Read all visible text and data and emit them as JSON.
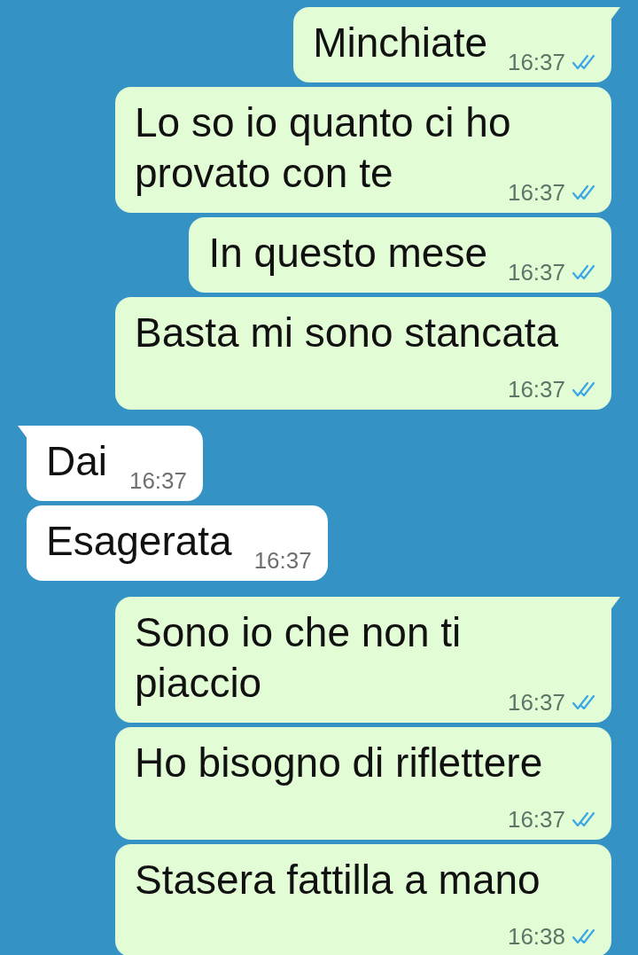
{
  "messages": [
    {
      "kind": "outgoing",
      "tail": true,
      "text": "Minchiate",
      "time": "16:37",
      "read": true
    },
    {
      "kind": "outgoing",
      "tail": false,
      "text": "Lo so io quanto ci ho provato con te",
      "time": "16:37",
      "read": true
    },
    {
      "kind": "outgoing",
      "tail": false,
      "text": "In questo mese",
      "time": "16:37",
      "read": true
    },
    {
      "kind": "outgoing",
      "tail": false,
      "text": "Basta mi sono stancata",
      "time": "16:37",
      "read": true
    },
    {
      "kind": "incoming",
      "tail": true,
      "text": "Dai",
      "time": "16:37"
    },
    {
      "kind": "incoming",
      "tail": false,
      "text": "Esagerata",
      "time": "16:37"
    },
    {
      "kind": "outgoing",
      "tail": true,
      "text": "Sono io che non ti piaccio",
      "time": "16:37",
      "read": true
    },
    {
      "kind": "outgoing",
      "tail": false,
      "text": "Ho bisogno di riflettere",
      "time": "16:37",
      "read": true
    },
    {
      "kind": "outgoing",
      "tail": false,
      "text": "Stasera fattilla a mano",
      "time": "16:38",
      "read": true
    }
  ]
}
